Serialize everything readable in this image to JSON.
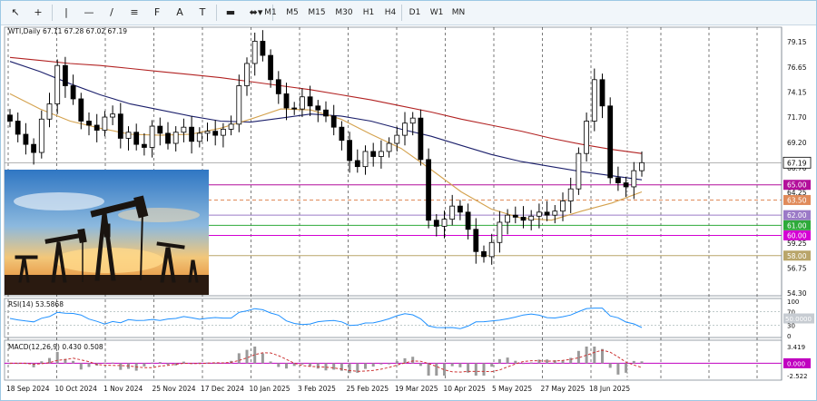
{
  "toolbar": {
    "tools": [
      {
        "name": "cursor-tool",
        "glyph": "↖"
      },
      {
        "name": "crosshair-tool",
        "glyph": "+"
      },
      {
        "name": "vertical-line-tool",
        "glyph": "|"
      },
      {
        "name": "horizontal-line-tool",
        "glyph": "—"
      },
      {
        "name": "trendline-tool",
        "glyph": "/"
      },
      {
        "name": "channel-tool",
        "glyph": "≡"
      },
      {
        "name": "fibonacci-tool",
        "glyph": "F"
      },
      {
        "name": "text-tool",
        "glyph": "A"
      },
      {
        "name": "label-tool",
        "glyph": "T"
      },
      {
        "name": "rectangle-tool",
        "glyph": "▬"
      },
      {
        "name": "shapes-dropdown",
        "glyph": "⬌▾"
      }
    ],
    "timeframes": [
      "M1",
      "M5",
      "M15",
      "M30",
      "H1",
      "H4",
      "D1",
      "W1",
      "MN"
    ]
  },
  "chart_header": {
    "symbol_line": "WTI,Daily  67.11 67.28 67.02 67.19"
  },
  "price_axis": {
    "ticks": [
      "79.15",
      "76.65",
      "74.15",
      "71.70",
      "69.20",
      "66.70",
      "64.25",
      "59.25",
      "56.75",
      "54.30"
    ],
    "current_price": "67.19",
    "level_labels": [
      {
        "text": "65.00",
        "color": "#b30f9b"
      },
      {
        "text": "63.50",
        "color": "#e08a5a"
      },
      {
        "text": "62.00",
        "color": "#9b7ac7"
      },
      {
        "text": "61.00",
        "color": "#2eaa3a"
      },
      {
        "text": "60.00",
        "color": "#d400d4"
      },
      {
        "text": "58.00",
        "color": "#b9a56a"
      }
    ]
  },
  "rsi": {
    "label": "RSI(14) 53.5868",
    "ticks": [
      "100",
      "70",
      "30",
      "0"
    ],
    "current_value": "50.0000"
  },
  "macd": {
    "label": "MACD(12,26,9) 0.430 0.508",
    "ticks": [
      "3.419",
      "0.000",
      "-2.522"
    ]
  },
  "time_axis": {
    "labels": [
      "18 Sep 2024",
      "10 Oct 2024",
      "1 Nov 2024",
      "25 Nov 2024",
      "17 Dec 2024",
      "10 Jan 2025",
      "3 Feb 2025",
      "25 Feb 2025",
      "19 Mar 2025",
      "10 Apr 2025",
      "5 May 2025",
      "27 May 2025",
      "18 Jun 2025"
    ]
  },
  "colors": {
    "ma_red": "#b22222",
    "ma_navy": "#1b1f6b",
    "ma_gold": "#d4a24e",
    "rsi_line": "#1e90ff",
    "macd_signal": "#cc3333",
    "accent_magenta": "#c000c0"
  },
  "chart_data": {
    "type": "candlestick",
    "price_levels": [
      65.0,
      63.5,
      62.0,
      61.0,
      60.0,
      58.0
    ],
    "last_close": 67.19,
    "price_range": [
      54.3,
      79.15
    ],
    "closes": [
      71.3,
      70.0,
      69.0,
      68.2,
      71.5,
      73.0,
      76.8,
      74.8,
      73.5,
      71.3,
      70.9,
      70.4,
      71.7,
      72.0,
      69.6,
      70.2,
      69.0,
      68.7,
      70.8,
      70.1,
      69.1,
      70.2,
      70.7,
      69.3,
      70.1,
      70.3,
      69.9,
      70.5,
      71.0,
      74.8,
      77.0,
      79.2,
      77.8,
      75.4,
      74.0,
      72.6,
      72.5,
      73.7,
      72.8,
      72.4,
      71.8,
      70.7,
      69.4,
      67.4,
      66.8,
      68.3,
      67.8,
      68.3,
      69.1,
      69.9,
      71.1,
      71.6,
      67.5,
      61.5,
      60.9,
      61.6,
      62.9,
      62.3,
      60.6,
      58.4,
      57.9,
      59.3,
      61.3,
      62.0,
      61.8,
      61.5,
      61.9,
      62.3,
      62.0,
      62.4,
      63.4,
      64.6,
      68.1,
      71.3,
      75.4,
      72.8,
      65.7,
      65.2,
      64.8,
      66.4,
      67.19
    ]
  }
}
